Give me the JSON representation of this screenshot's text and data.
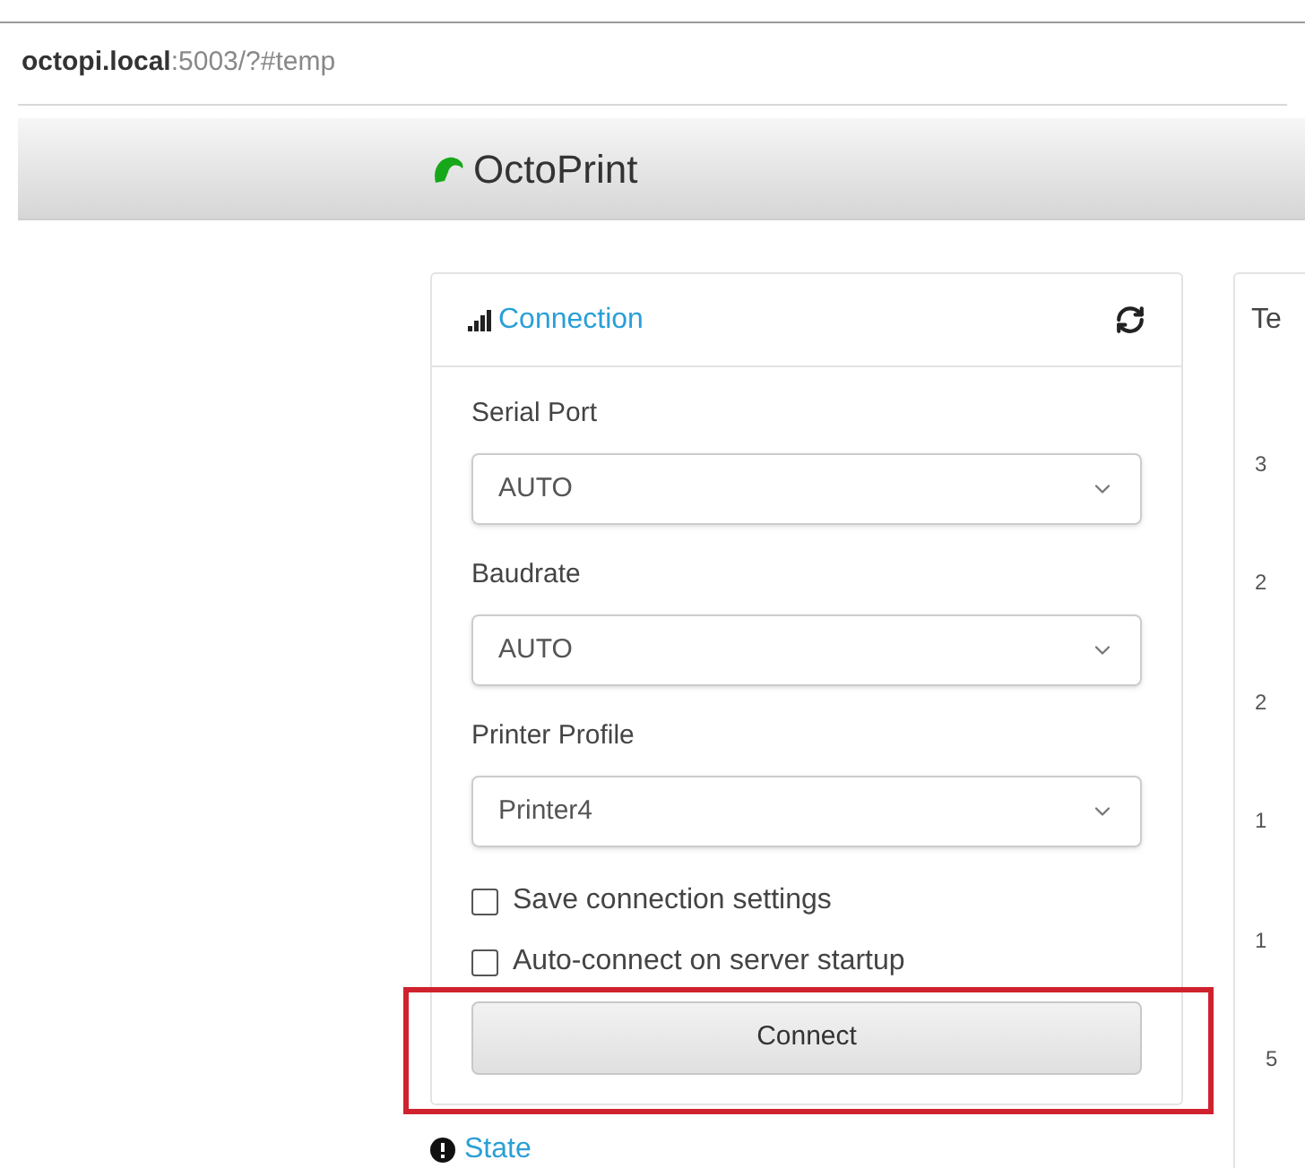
{
  "address_bar": {
    "host": "octopi.local",
    "path": ":5003/?#temp"
  },
  "navbar": {
    "brand": "OctoPrint"
  },
  "connection_panel": {
    "title": "Connection",
    "fields": [
      {
        "label": "Serial Port",
        "value": "AUTO"
      },
      {
        "label": "Baudrate",
        "value": "AUTO"
      },
      {
        "label": "Printer Profile",
        "value": "Printer4"
      }
    ],
    "checkboxes": [
      {
        "label": "Save connection settings",
        "checked": false
      },
      {
        "label": "Auto-connect on server startup",
        "checked": false
      }
    ],
    "button": "Connect"
  },
  "state_panel": {
    "title": "State"
  },
  "temperature_panel": {
    "title": "Te",
    "axis_labels": [
      "3",
      "2",
      "2",
      "1",
      "1",
      "5"
    ]
  }
}
